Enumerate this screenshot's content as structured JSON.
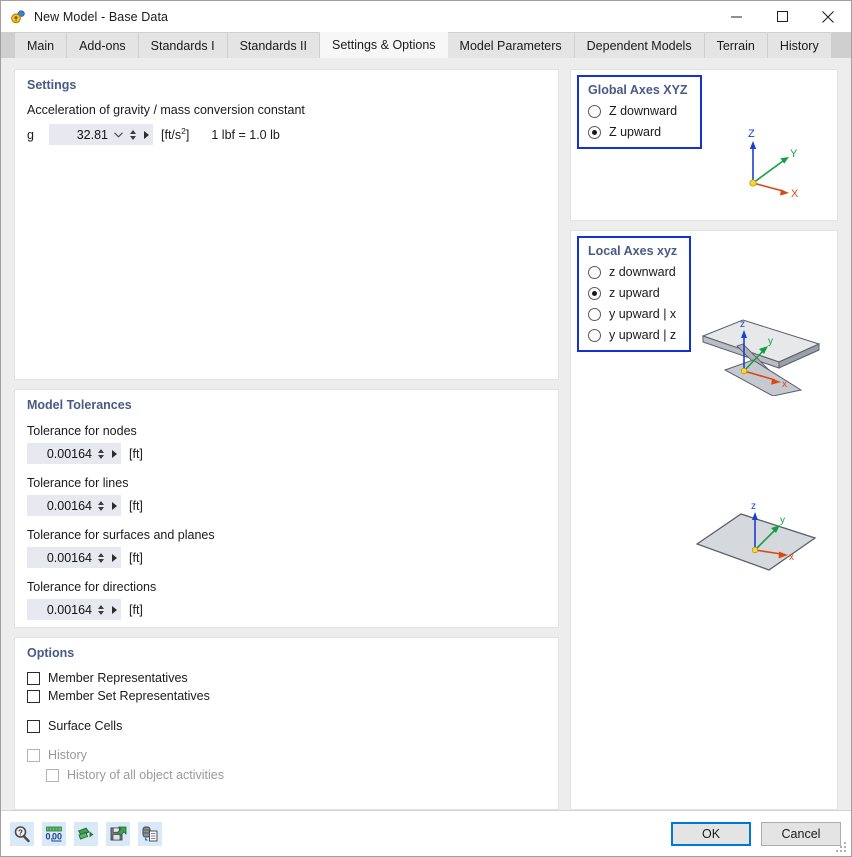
{
  "window": {
    "title": "New Model - Base Data",
    "icon": "new-model-icon",
    "minimize": "—",
    "maximize": "❑",
    "close": "✕"
  },
  "tabs": [
    {
      "label": "Main",
      "active": false
    },
    {
      "label": "Add-ons",
      "active": false
    },
    {
      "label": "Standards I",
      "active": false
    },
    {
      "label": "Standards II",
      "active": false
    },
    {
      "label": "Settings & Options",
      "active": true
    },
    {
      "label": "Model Parameters",
      "active": false
    },
    {
      "label": "Dependent Models",
      "active": false
    },
    {
      "label": "Terrain",
      "active": false
    },
    {
      "label": "History",
      "active": false
    }
  ],
  "settings": {
    "title": "Settings",
    "gravity_label": "Acceleration of gravity / mass conversion constant",
    "gravity_symbol": "g",
    "gravity_value": "32.81",
    "gravity_unit": "[ft/s",
    "gravity_unit_sup": "2",
    "gravity_unit_close": "]",
    "conversion_note": "1 lbf = 1.0 lb"
  },
  "tolerances": {
    "title": "Model Tolerances",
    "unit": "[ft]",
    "rows": [
      {
        "label": "Tolerance for nodes",
        "value": "0.00164"
      },
      {
        "label": "Tolerance for lines",
        "value": "0.00164"
      },
      {
        "label": "Tolerance for surfaces and planes",
        "value": "0.00164"
      },
      {
        "label": "Tolerance for directions",
        "value": "0.00164"
      }
    ]
  },
  "options": {
    "title": "Options",
    "items": [
      {
        "label": "Member Representatives",
        "checked": false,
        "disabled": false,
        "indent": false
      },
      {
        "label": "Member Set Representatives",
        "checked": false,
        "disabled": false,
        "indent": false
      },
      {
        "label": "Surface Cells",
        "checked": false,
        "disabled": false,
        "indent": false
      },
      {
        "label": "History",
        "checked": false,
        "disabled": true,
        "indent": false
      },
      {
        "label": "History of all object activities",
        "checked": false,
        "disabled": true,
        "indent": true
      }
    ]
  },
  "global_axes": {
    "title": "Global Axes XYZ",
    "options": [
      {
        "label": "Z downward",
        "selected": false
      },
      {
        "label": "Z upward",
        "selected": true
      }
    ],
    "graphic_labels": {
      "z": "Z",
      "y": "Y",
      "x": "X"
    }
  },
  "local_axes": {
    "title": "Local Axes xyz",
    "options": [
      {
        "label": "z downward",
        "selected": false
      },
      {
        "label": "z upward",
        "selected": true
      },
      {
        "label": "y upward | x",
        "selected": false
      },
      {
        "label": "y upward | z",
        "selected": false
      }
    ],
    "graphic_labels": {
      "z": "z",
      "y": "y",
      "x": "x"
    }
  },
  "footer": {
    "tools": [
      {
        "name": "help-magnifier-icon"
      },
      {
        "name": "number-format-icon"
      },
      {
        "name": "import-icon"
      },
      {
        "name": "save-icon"
      },
      {
        "name": "copy-icon"
      }
    ],
    "ok_label": "OK",
    "cancel_label": "Cancel"
  },
  "colors": {
    "accent_blue": "#1431d2",
    "focus_blue": "#0078d7",
    "header_text": "#4a5a86",
    "axis_x": "#d94a10",
    "axis_y": "#12a040",
    "axis_z": "#1f3fcf"
  }
}
